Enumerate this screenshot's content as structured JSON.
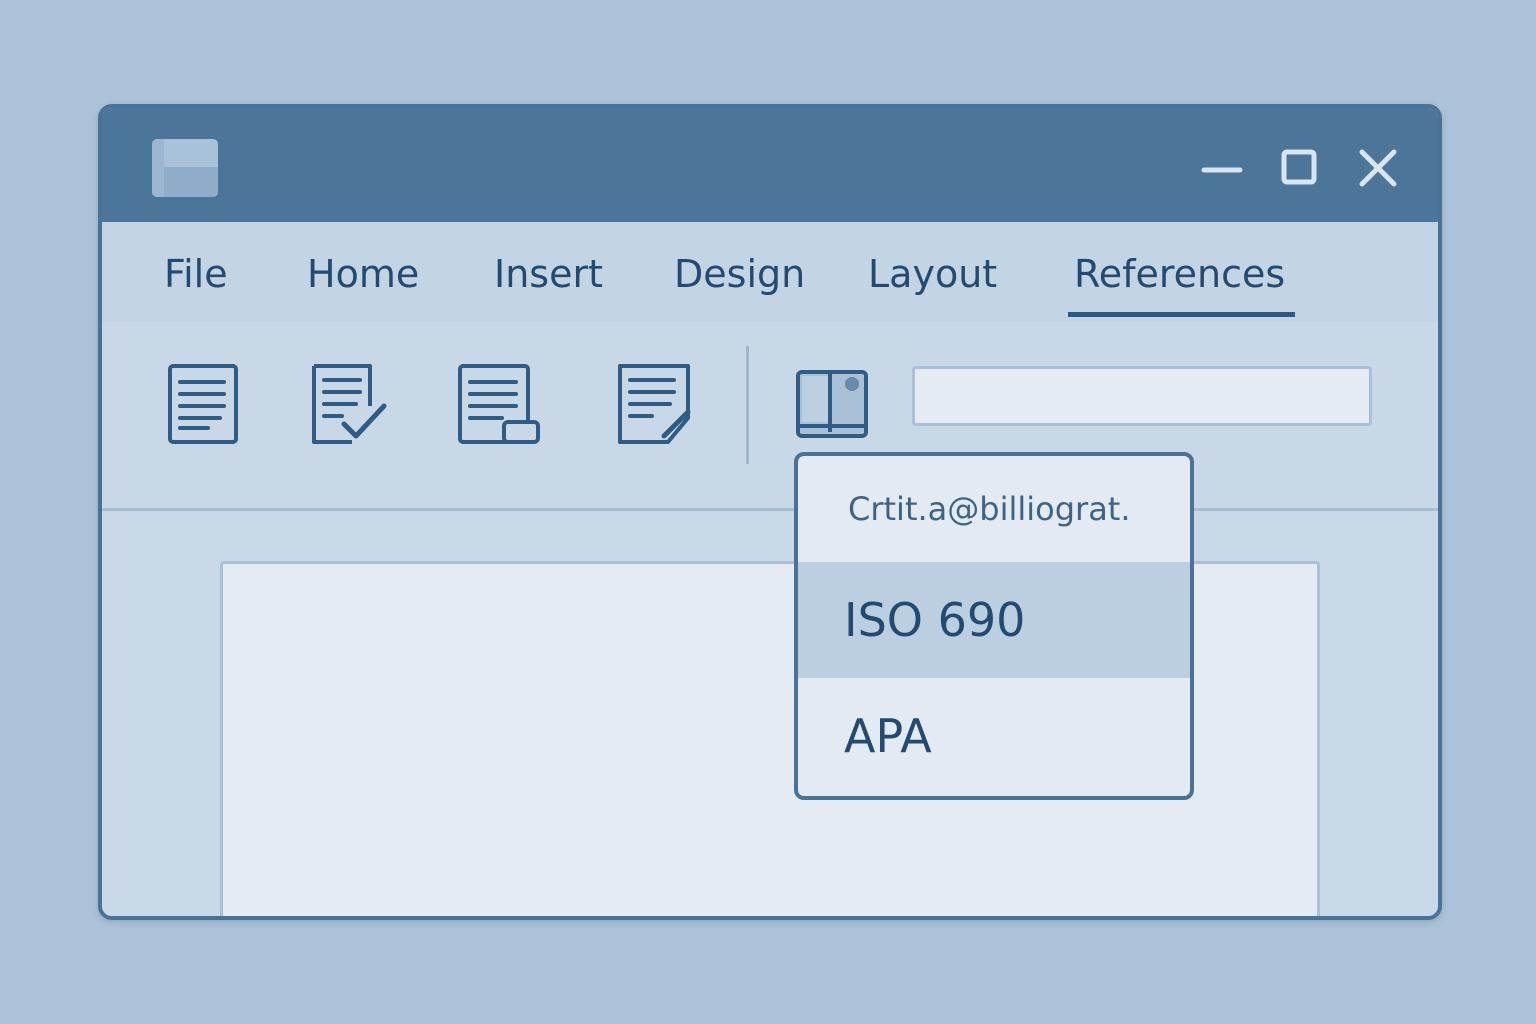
{
  "window": {
    "app_icon": "document-app-icon",
    "controls": [
      "minimize-icon",
      "maximize-icon",
      "close-icon"
    ]
  },
  "tabs": [
    {
      "label": "File",
      "active": false
    },
    {
      "label": "Home",
      "active": false
    },
    {
      "label": "Insert",
      "active": false
    },
    {
      "label": "Design",
      "active": false
    },
    {
      "label": "Layout",
      "active": false
    },
    {
      "label": "References",
      "active": true
    }
  ],
  "ribbon": {
    "icons": [
      "table-of-contents-icon",
      "check-document-icon",
      "caption-icon",
      "edit-document-icon",
      "bibliography-book-icon"
    ],
    "style_field": {
      "value": "",
      "placeholder": ""
    }
  },
  "dropdown": {
    "header": "Crtit.a@billiograt.",
    "items": [
      {
        "label": "ISO 690",
        "selected": true
      },
      {
        "label": "APA",
        "selected": false
      }
    ]
  },
  "colors": {
    "background": "#abc2d8",
    "titlebar": "#4b7699",
    "accent": "#2e5a82",
    "text": "#234a70"
  }
}
